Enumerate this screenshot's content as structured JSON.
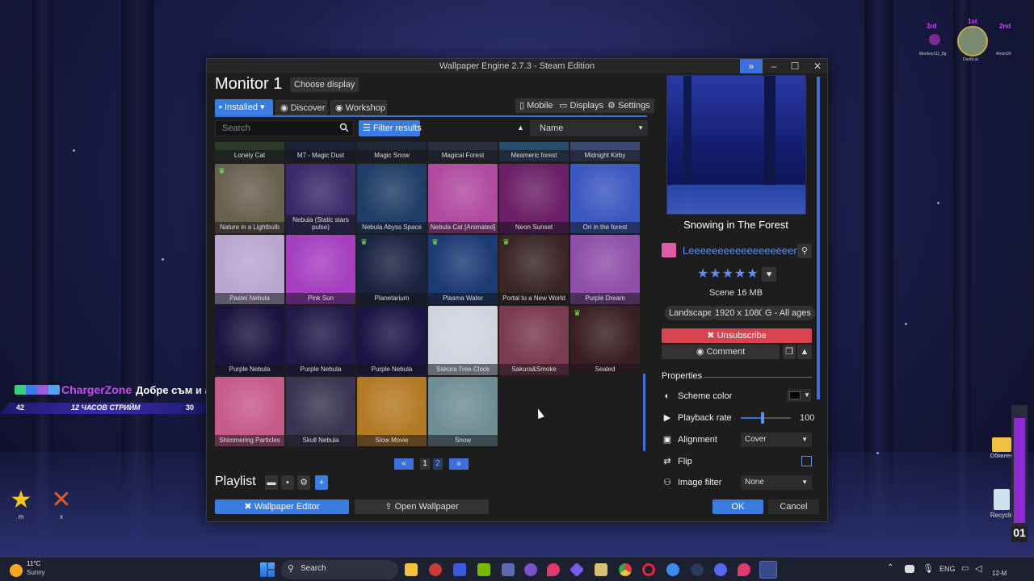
{
  "window": {
    "title": "Wallpaper Engine 2.7.3 - Steam Edition",
    "monitor": "Monitor 1",
    "choose_display": "Choose display"
  },
  "tabs": {
    "installed": "Installed",
    "discover": "Discover",
    "workshop": "Workshop",
    "mobile": "Mobile",
    "displays": "Displays",
    "settings": "Settings"
  },
  "search": {
    "placeholder": "Search"
  },
  "filter": {
    "label": "Filter results"
  },
  "sort": {
    "value": "Name"
  },
  "top_row": [
    "Lonely Cat",
    "M7 - Magic Dust",
    "Magic Snow",
    "Magical Forest",
    "Mesmeric forest",
    "Midnight Kirby"
  ],
  "items": [
    {
      "name": "Nature in a Lightbulb",
      "bg": "#6a6050",
      "trophy": true
    },
    {
      "name": "Nebula (Static stars pulse)",
      "bg": "#3a2a6a",
      "trophy": false
    },
    {
      "name": "Nebula Abyss Space",
      "bg": "#1f3d66",
      "trophy": false
    },
    {
      "name": "Nebula Cat [Animated]",
      "bg": "#b04aa0",
      "trophy": false
    },
    {
      "name": "Neon Sunset",
      "bg": "#6a1f66",
      "trophy": false
    },
    {
      "name": "Ori in the forest",
      "bg": "#3b57c0",
      "trophy": false
    },
    {
      "name": "Pastel Nebula",
      "bg": "#b9a6cf",
      "trophy": false
    },
    {
      "name": "Pink Sun",
      "bg": "#a53fc0",
      "trophy": false
    },
    {
      "name": "Planetarium",
      "bg": "#1a2340",
      "trophy": true
    },
    {
      "name": "Plasma Water",
      "bg": "#1c3b74",
      "trophy": true
    },
    {
      "name": "Portal to a New World",
      "bg": "#3a2526",
      "trophy": true
    },
    {
      "name": "Purple Dream",
      "bg": "#8f4fa8",
      "trophy": false
    },
    {
      "name": "Purple Nebula",
      "bg": "#1c1440",
      "trophy": false
    },
    {
      "name": "Purple Nebula",
      "bg": "#221a4a",
      "trophy": false
    },
    {
      "name": "Purple Nebula",
      "bg": "#1d1546",
      "trophy": false
    },
    {
      "name": "Sakura Tree Clock",
      "bg": "#cfd4e0",
      "trophy": false
    },
    {
      "name": "Sakura&Smoke",
      "bg": "#7a3a50",
      "trophy": false
    },
    {
      "name": "Sealed",
      "bg": "#3a1f22",
      "trophy": true
    },
    {
      "name": "Shimmering Particles",
      "bg": "#c65a8a",
      "trophy": false
    },
    {
      "name": "Skull Nebula",
      "bg": "#3a3450",
      "trophy": false
    },
    {
      "name": "Slow Movie",
      "bg": "#b37a25",
      "trophy": false
    },
    {
      "name": "Snow",
      "bg": "#6f8e94",
      "trophy": false
    }
  ],
  "pagination": {
    "pages": [
      "1",
      "2"
    ]
  },
  "playlist": {
    "label": "Playlist"
  },
  "bottom": {
    "editor": "Wallpaper Editor",
    "open": "Open Wallpaper",
    "ok": "OK",
    "cancel": "Cancel"
  },
  "details": {
    "title": "Snowing in The Forest",
    "author": "Leeeeeeeeeeeeeeeeeen",
    "rating": "★★★★★",
    "type": "Scene",
    "size": "16 MB",
    "tags": [
      "Landscape",
      "1920 x 1080",
      "G - All ages"
    ],
    "unsubscribe": "Unsubscribe",
    "comment": "Comment"
  },
  "properties": {
    "header": "Properties",
    "scheme_color": "Scheme color",
    "scheme_color_value": "#000000",
    "playback_rate": "Playback rate",
    "playback_value": "100",
    "playback_fraction": 0.4,
    "alignment": "Alignment",
    "alignment_value": "Cover",
    "flip": "Flip",
    "image_filter": "Image filter",
    "image_filter_value": "None"
  },
  "overlay": {
    "streamer": "ChargerZone",
    "message": "Добре съм и аз. Почивка съм.",
    "bar_left": "42",
    "bar_center": "12 ЧАСОВ СТРИЙМ",
    "bar_right": "30",
    "ranks": [
      "3rd",
      "1st",
      "2nd"
    ],
    "rank_names": [
      "Monkey111_8g",
      "DashLuL",
      "Amon30"
    ]
  },
  "desktop": {
    "icon1": "m",
    "icon2": "x",
    "folder": "Обявлен",
    "recycle": "Recycle"
  },
  "taskbar": {
    "temp": "11°C",
    "weather": "Sunny",
    "search": "Search",
    "lang": "ENG",
    "clock": "12-M"
  }
}
